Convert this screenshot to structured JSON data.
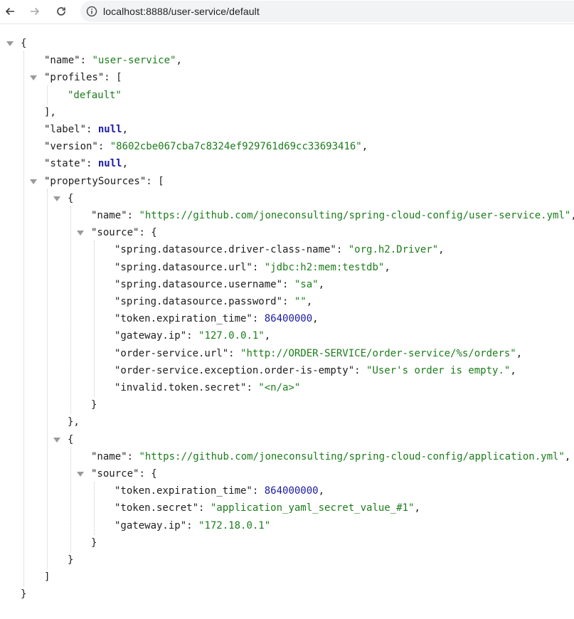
{
  "browser": {
    "url": "localhost:8888/user-service/default",
    "icons": [
      "back-arrow-icon",
      "forward-arrow-icon",
      "reload-icon",
      "info-icon"
    ]
  },
  "json": {
    "open_brace": "{",
    "close_brace": "}",
    "name_key": "\"name\"",
    "name_value": "\"user-service\"",
    "profiles_key": "\"profiles\"",
    "profiles_item": "\"default\"",
    "label_key": "\"label\"",
    "label_value": "null",
    "version_key": "\"version\"",
    "version_value": "\"8602cbe067cba7c8324ef929761d69cc33693416\"",
    "state_key": "\"state\"",
    "state_value": "null",
    "property_sources_key": "\"propertySources\"",
    "sources": [
      {
        "name_key": "\"name\"",
        "name_value": "\"https://github.com/joneconsulting/spring-cloud-config/user-service.yml\"",
        "source_key": "\"source\"",
        "props": [
          {
            "k": "\"spring.datasource.driver-class-name\"",
            "v": "\"org.h2.Driver\"",
            "t": "str",
            "comma": true
          },
          {
            "k": "\"spring.datasource.url\"",
            "v": "\"jdbc:h2:mem:testdb\"",
            "t": "str",
            "comma": true
          },
          {
            "k": "\"spring.datasource.username\"",
            "v": "\"sa\"",
            "t": "str",
            "comma": true
          },
          {
            "k": "\"spring.datasource.password\"",
            "v": "\"\"",
            "t": "str",
            "comma": true
          },
          {
            "k": "\"token.expiration_time\"",
            "v": "86400000",
            "t": "num",
            "comma": true
          },
          {
            "k": "\"gateway.ip\"",
            "v": "\"127.0.0.1\"",
            "t": "str",
            "comma": true
          },
          {
            "k": "\"order-service.url\"",
            "v": "\"http://ORDER-SERVICE/order-service/%s/orders\"",
            "t": "str",
            "comma": true
          },
          {
            "k": "\"order-service.exception.order-is-empty\"",
            "v": "\"User's order is empty.\"",
            "t": "str",
            "comma": true
          },
          {
            "k": "\"invalid.token.secret\"",
            "v": "\"<n/a>\"",
            "t": "str",
            "comma": false
          }
        ]
      },
      {
        "name_key": "\"name\"",
        "name_value": "\"https://github.com/joneconsulting/spring-cloud-config/application.yml\"",
        "source_key": "\"source\"",
        "props": [
          {
            "k": "\"token.expiration_time\"",
            "v": "864000000",
            "t": "num",
            "comma": true
          },
          {
            "k": "\"token.secret\"",
            "v": "\"application_yaml_secret_value_#1\"",
            "t": "str",
            "comma": true
          },
          {
            "k": "\"gateway.ip\"",
            "v": "\"172.18.0.1\"",
            "t": "str",
            "comma": false
          }
        ]
      }
    ]
  },
  "colors": {
    "key": "#202020",
    "string": "#1c7d1c",
    "number": "#1a1aa6",
    "null": "#1a1aa6",
    "toggle": "#9a9a9a"
  }
}
